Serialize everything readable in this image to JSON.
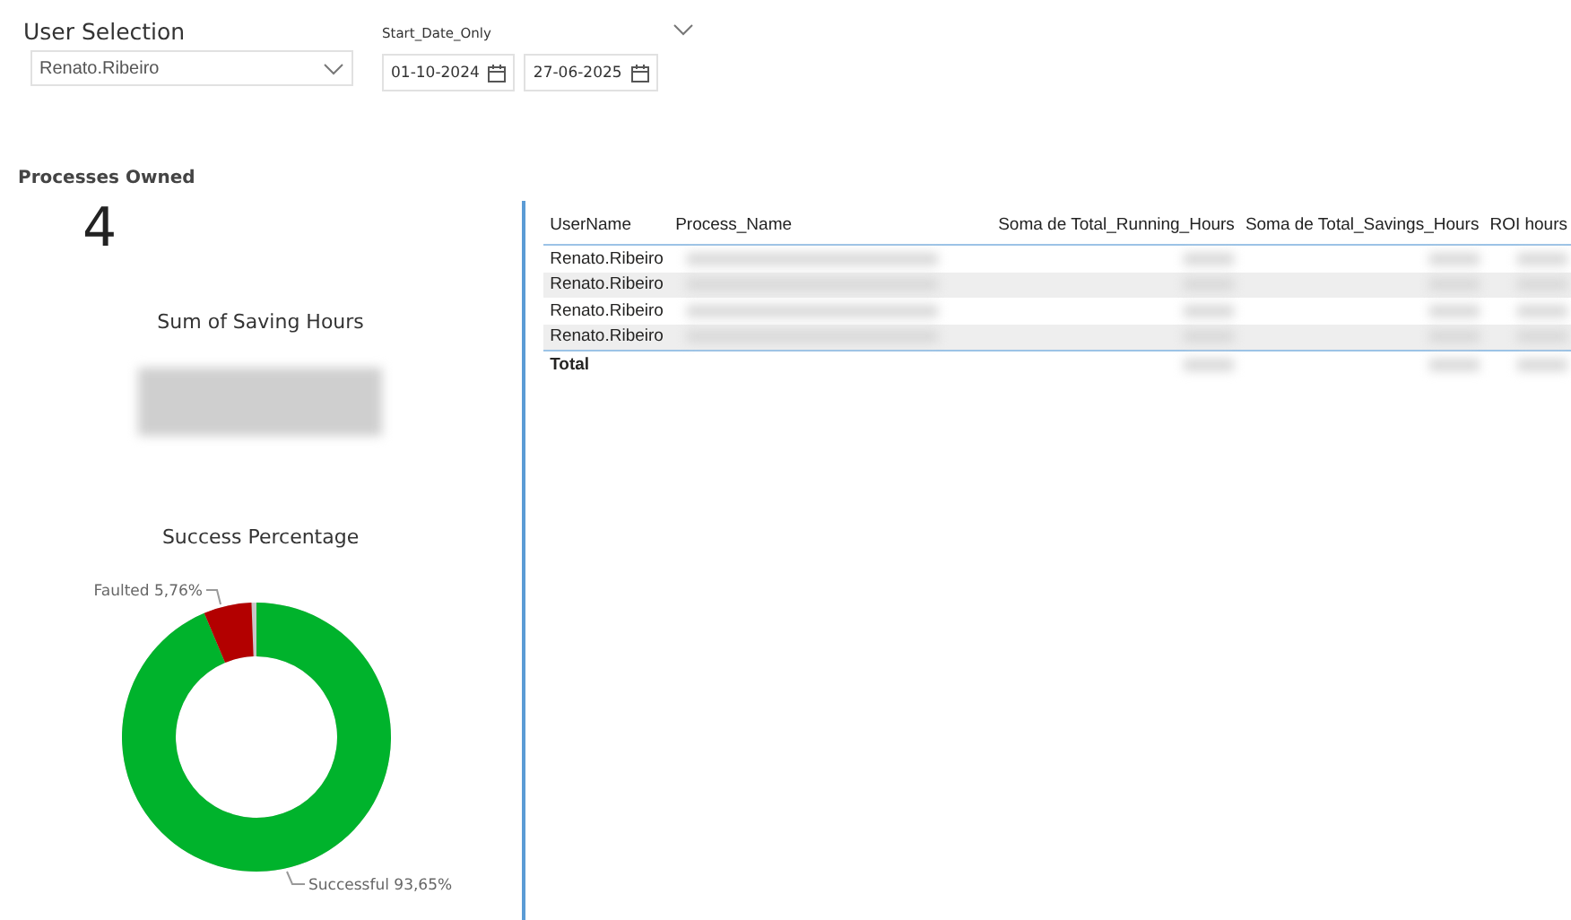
{
  "user_selection": {
    "title": "User Selection",
    "value": "Renato.Ribeiro"
  },
  "date_slicer": {
    "title": "Start_Date_Only",
    "start": "01-10-2024",
    "end": "27-06-2025"
  },
  "processes_owned": {
    "title": "Processes Owned",
    "value": "4"
  },
  "saving_hours": {
    "title": "Sum of Saving Hours",
    "redacted": true
  },
  "success": {
    "chart_data": {
      "type": "donut",
      "title": "Success Percentage",
      "categories": [
        "Successful",
        "Faulted"
      ],
      "values": [
        93.65,
        5.76
      ],
      "colors": [
        "#00b32c",
        "#b30000"
      ],
      "value_labels": [
        "93,65%",
        "5,76%"
      ]
    }
  },
  "table": {
    "columns": [
      "UserName",
      "Process_Name",
      "Soma de Total_Running_Hours",
      "Soma de Total_Savings_Hours",
      "ROI hours"
    ],
    "rows": [
      {
        "cells": [
          {
            "kind": "text",
            "text": "Renato.Ribeiro"
          },
          {
            "kind": "redacted"
          },
          {
            "kind": "redacted"
          },
          {
            "kind": "redacted"
          },
          {
            "kind": "redacted"
          }
        ]
      },
      {
        "cells": [
          {
            "kind": "text",
            "text": "Renato.Ribeiro"
          },
          {
            "kind": "redacted"
          },
          {
            "kind": "redacted"
          },
          {
            "kind": "redacted"
          },
          {
            "kind": "redacted"
          }
        ]
      },
      {
        "cells": [
          {
            "kind": "text",
            "text": "Renato.Ribeiro"
          },
          {
            "kind": "redacted"
          },
          {
            "kind": "redacted"
          },
          {
            "kind": "redacted"
          },
          {
            "kind": "redacted"
          }
        ]
      },
      {
        "cells": [
          {
            "kind": "text",
            "text": "Renato.Ribeiro"
          },
          {
            "kind": "redacted"
          },
          {
            "kind": "redacted"
          },
          {
            "kind": "redacted"
          },
          {
            "kind": "redacted"
          }
        ]
      }
    ],
    "total": {
      "cells": [
        {
          "kind": "text",
          "text": "Total"
        },
        {
          "kind": "empty"
        },
        {
          "kind": "redacted"
        },
        {
          "kind": "redacted"
        },
        {
          "kind": "redacted"
        }
      ]
    }
  }
}
